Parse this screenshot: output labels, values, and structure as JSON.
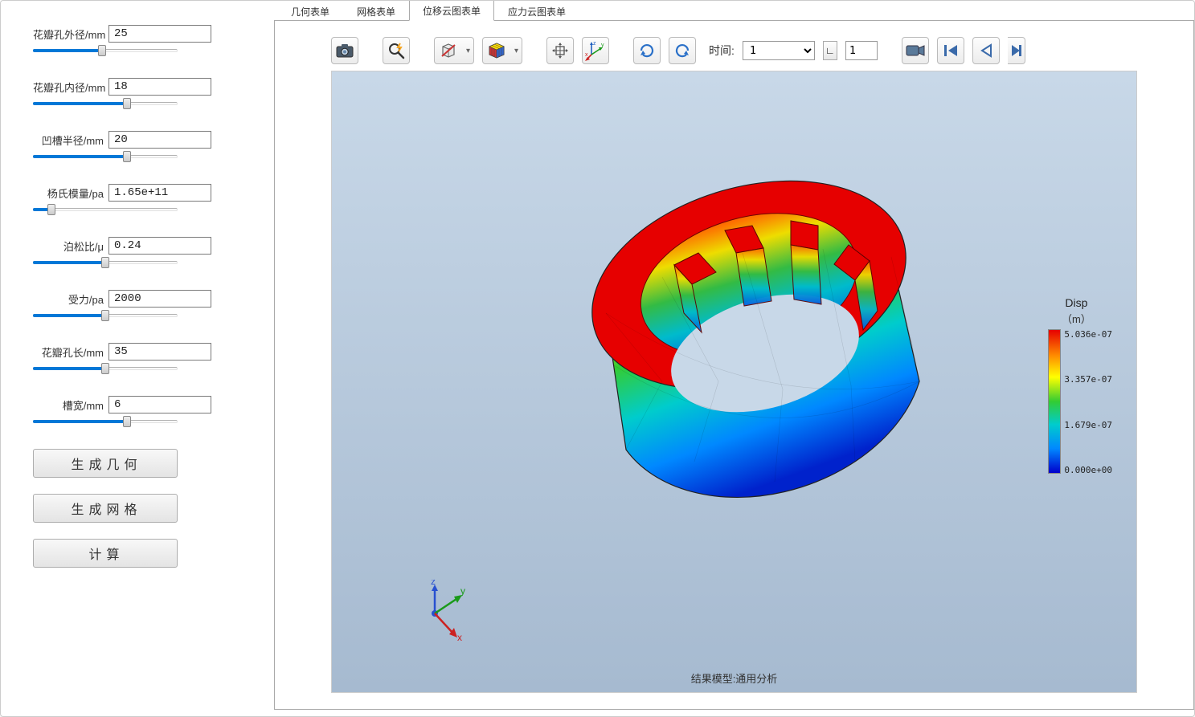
{
  "sidebar": {
    "params": [
      {
        "label": "花瓣孔外径/mm",
        "value": "25",
        "slider_pct": 48
      },
      {
        "label": "花瓣孔内径/mm",
        "value": "18",
        "slider_pct": 65
      },
      {
        "label": "凹槽半径/mm",
        "value": "20",
        "slider_pct": 65
      },
      {
        "label": "杨氏模量/pa",
        "value": "1.65e+11",
        "slider_pct": 13
      },
      {
        "label": "泊松比/μ",
        "value": "0.24",
        "slider_pct": 50
      },
      {
        "label": "受力/pa",
        "value": "2000",
        "slider_pct": 50
      },
      {
        "label": "花瓣孔长/mm",
        "value": "35",
        "slider_pct": 50
      },
      {
        "label": "槽宽/mm",
        "value": "6",
        "slider_pct": 65
      }
    ],
    "buttons": [
      {
        "label": "生成几何"
      },
      {
        "label": "生成网格"
      },
      {
        "label": "计算"
      }
    ]
  },
  "tabs": [
    {
      "label": "几何表单",
      "active": false
    },
    {
      "label": "网格表单",
      "active": false
    },
    {
      "label": "位移云图表单",
      "active": true
    },
    {
      "label": "应力云图表单",
      "active": false
    }
  ],
  "toolbar": {
    "time_label": "时间:",
    "time_select_value": "1",
    "time_step_value": "1",
    "icons": [
      "camera-icon",
      "zoom-lightning-icon",
      "cube-slash-icon",
      "rubik-cube-icon",
      "move-icon",
      "axes-xyz-icon",
      "rotate-cw-icon",
      "rotate-ccw-icon",
      "video-camera-icon",
      "skip-first-icon",
      "skip-prev-icon",
      "skip-last-icon"
    ]
  },
  "viewer": {
    "caption": "结果模型:通用分析",
    "triad_labels": {
      "x": "x",
      "y": "y",
      "z": "z"
    },
    "colorbar": {
      "title": "Disp",
      "unit": "（m）",
      "ticks": [
        "5.036e-07",
        "3.357e-07",
        "1.679e-07",
        "0.000e+00"
      ]
    }
  },
  "chart_data": {
    "type": "heatmap",
    "description": "FEA displacement contour plot on a splined/cylindrical bushing with internal petal key profile",
    "field": "Displacement",
    "unit": "m",
    "range_min": 0.0,
    "range_max": 5.036e-07,
    "ticks": [
      0.0,
      1.679e-07,
      3.357e-07,
      5.036e-07
    ],
    "colormap": [
      "#0000cc",
      "#0088ff",
      "#00cccc",
      "#33cc33",
      "#ffff00",
      "#ff8c00",
      "#e60000"
    ],
    "notes": "Maximum (red) displacement at the top rim/face; minimum (blue) at the bottom base; monotonic gradient along the axial direction.",
    "time_step": 1,
    "time_value": 1,
    "title": "结果模型:通用分析"
  }
}
